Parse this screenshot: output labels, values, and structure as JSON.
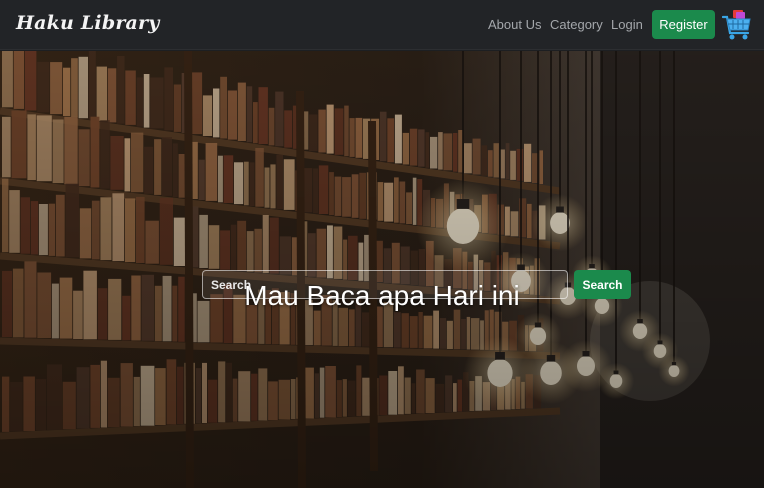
{
  "navbar": {
    "brand": "Haku Library",
    "links": [
      "About Us",
      "Category",
      "Login"
    ],
    "register_label": "Register",
    "cart_icon": "shopping-cart-icon"
  },
  "hero": {
    "title": "Mau Baca apa Hari ini",
    "search_placeholder": "Search",
    "search_button": "Search",
    "background": "library-bookshelves-with-hanging-bulbs"
  },
  "colors": {
    "navbar_bg": "#222427",
    "accent_green": "#1b8a4c",
    "nav_link": "#a4a7ab"
  }
}
